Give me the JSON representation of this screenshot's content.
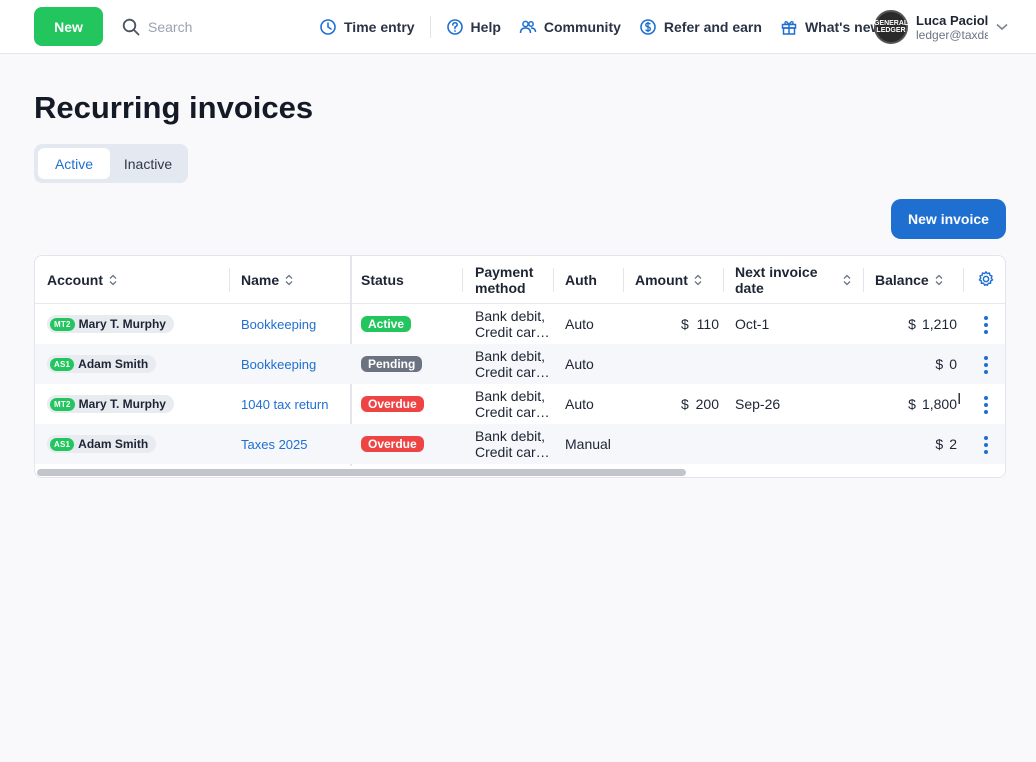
{
  "topbar": {
    "new_label": "New",
    "search_placeholder": "Search",
    "nav": [
      {
        "label": "Time entry",
        "icon": "clock-icon"
      },
      {
        "label": "Help",
        "icon": "help-icon"
      },
      {
        "label": "Community",
        "icon": "community-icon"
      },
      {
        "label": "Refer and earn",
        "icon": "dollar-icon"
      },
      {
        "label": "What's new",
        "icon": "gift-icon"
      }
    ],
    "user": {
      "name": "Luca Pacioli",
      "email": "ledger@taxdε",
      "avatar_text": "GENERAL LEDGER"
    }
  },
  "page": {
    "title": "Recurring invoices",
    "tabs": [
      "Active",
      "Inactive"
    ],
    "active_tab": "Active",
    "new_invoice_label": "New invoice"
  },
  "table": {
    "columns": [
      "Account",
      "Name",
      "Status",
      "Payment method",
      "Auth",
      "Amount",
      "Next invoice date",
      "Balance"
    ],
    "columns_split": {
      "payment_1": "Payment",
      "payment_2": "method",
      "next_1": "Next invoice",
      "next_2": "date"
    },
    "rows": [
      {
        "badge": "MT2",
        "account": "Mary T. Murphy",
        "name": "Bookkeeping",
        "status": "Active",
        "pay_1": "Bank debit,",
        "pay_2": "Credit car…",
        "auth": "Auto",
        "amount_symbol": "$",
        "amount": "110",
        "next_date": "Oct-1",
        "balance_symbol": "$",
        "balance": "1,210"
      },
      {
        "badge": "AS1",
        "account": "Adam Smith",
        "name": "Bookkeeping",
        "status": "Pending",
        "pay_1": "Bank debit,",
        "pay_2": "Credit car…",
        "auth": "Auto",
        "amount_symbol": "",
        "amount": "",
        "next_date": "",
        "balance_symbol": "$",
        "balance": "0"
      },
      {
        "badge": "MT2",
        "account": "Mary T. Murphy",
        "name": "1040 tax return",
        "status": "Overdue",
        "pay_1": "Bank debit,",
        "pay_2": "Credit car…",
        "auth": "Auto",
        "amount_symbol": "$",
        "amount": "200",
        "next_date": "Sep-26",
        "balance_symbol": "$",
        "balance": "1,800"
      },
      {
        "badge": "AS1",
        "account": "Adam Smith",
        "name": "Taxes 2025",
        "status": "Overdue",
        "pay_1": "Bank debit,",
        "pay_2": "Credit car…",
        "auth": "Manual",
        "amount_symbol": "",
        "amount": "",
        "next_date": "",
        "balance_symbol": "$",
        "balance": "2"
      }
    ]
  },
  "colors": {
    "primary": "#1f6fd1",
    "new_button": "#22c55e",
    "status_active": "#22c55e",
    "status_pending": "#6b7280",
    "status_overdue": "#ef4444"
  }
}
